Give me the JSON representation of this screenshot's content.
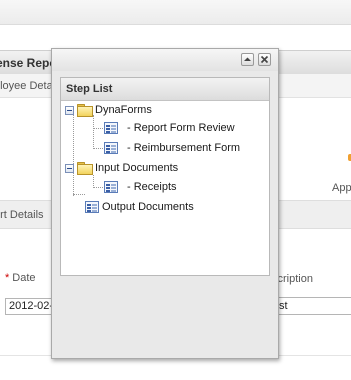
{
  "background": {
    "report_title": "ense Report",
    "subheader": "ployee Deta",
    "app_label": "App",
    "section_label": "ort Details",
    "date_label": "Date",
    "date_required_mark": "*",
    "date_value": "2012-02-",
    "description_label": "scription",
    "description_value": "st"
  },
  "popup": {
    "panel_title": "Step List",
    "tree": [
      {
        "label": "DynaForms",
        "type": "folder",
        "children": [
          {
            "label": "- Report Form Review",
            "type": "step"
          },
          {
            "label": "- Reimbursement Form",
            "type": "step"
          }
        ]
      },
      {
        "label": "Input Documents",
        "type": "folder",
        "children": [
          {
            "label": "- Receipts",
            "type": "step"
          }
        ]
      },
      {
        "label": "Output Documents",
        "type": "step"
      }
    ],
    "icons": {
      "minimize": "minimize-icon",
      "close": "close-icon",
      "folder": "folder-icon",
      "step": "step-icon",
      "collapse": "collapse-toggle-icon"
    }
  }
}
